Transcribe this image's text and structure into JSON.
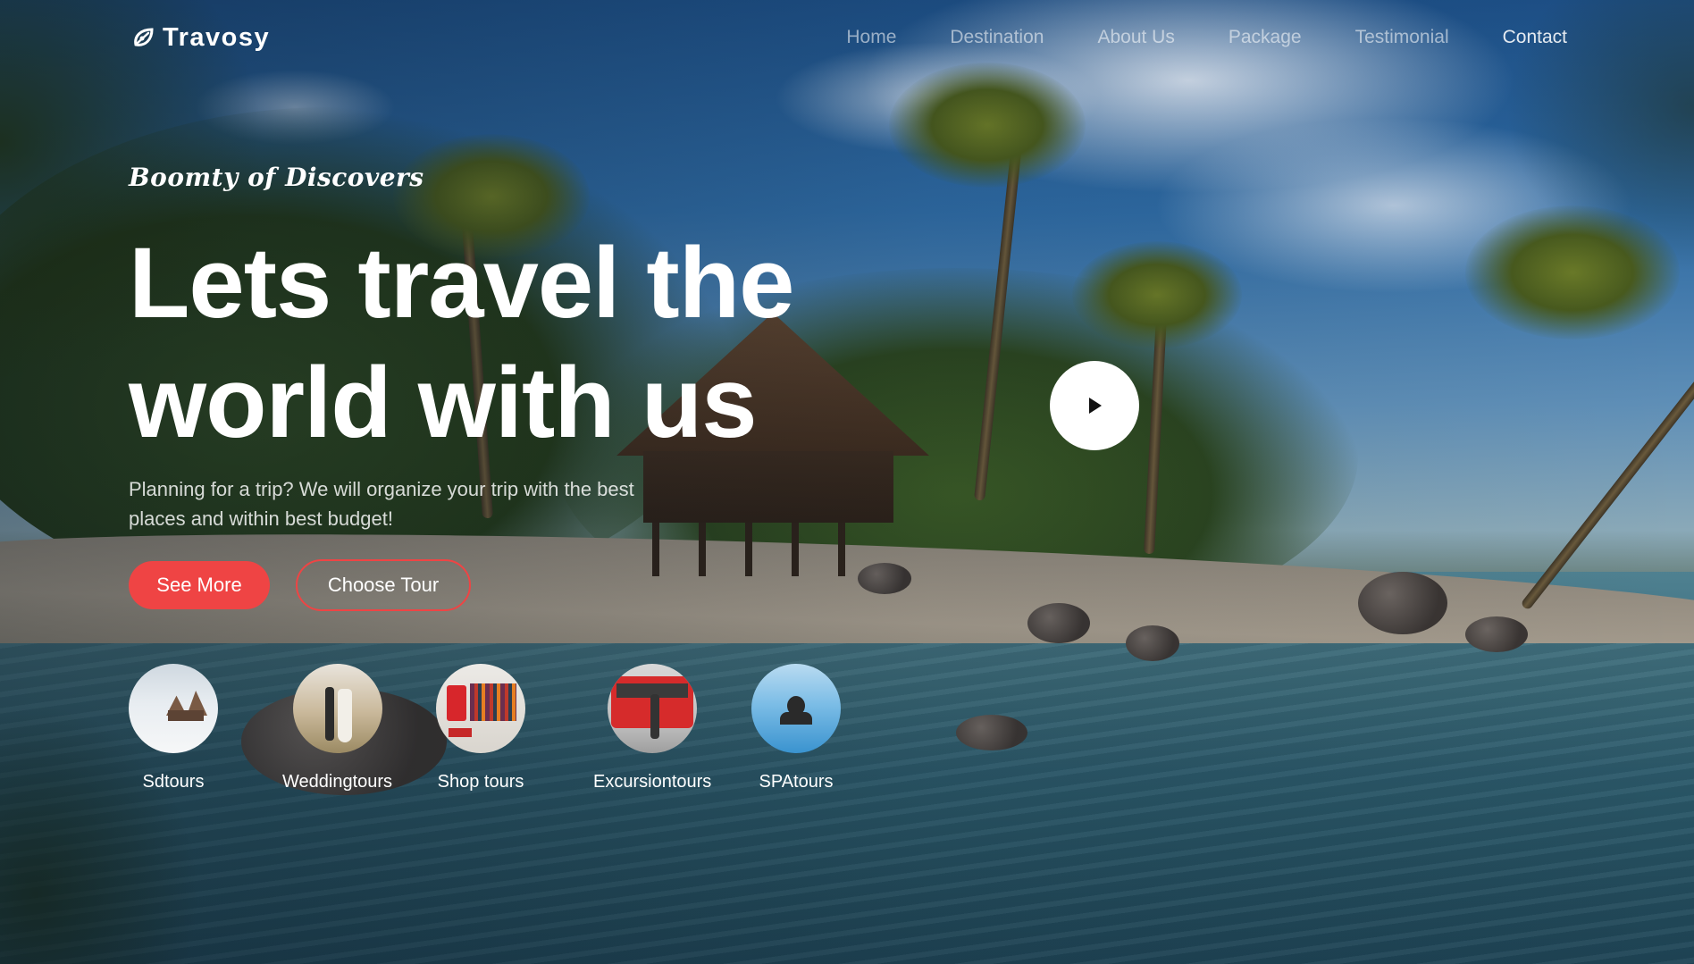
{
  "brand": {
    "name": "Travosy"
  },
  "nav": {
    "items": [
      "Home",
      "Destination",
      "About Us",
      "Package",
      "Testimonial",
      "Contact"
    ]
  },
  "hero": {
    "tagline": "Boomty of Discovers",
    "headline_line1": "Lets travel the",
    "headline_line2": "world with us",
    "subtext": "Planning for a trip? We will organize your trip with the best places and within best budget!",
    "primary_button": "See More",
    "secondary_button": "Choose Tour"
  },
  "categories": [
    {
      "label": "Sdtours",
      "icon": "snowy-cabin-thumbnail"
    },
    {
      "label": "Weddingtours",
      "icon": "wedding-couple-thumbnail"
    },
    {
      "label": "Shop tours",
      "icon": "clothing-rack-thumbnail"
    },
    {
      "label": "Excursiontours",
      "icon": "red-bus-thumbnail"
    },
    {
      "label": "SPAtours",
      "icon": "infinity-pool-thumbnail"
    }
  ],
  "colors": {
    "accent": "#ef4444",
    "text": "#ffffff",
    "nav_inactive": "rgba(255,255,255,0.55)"
  }
}
